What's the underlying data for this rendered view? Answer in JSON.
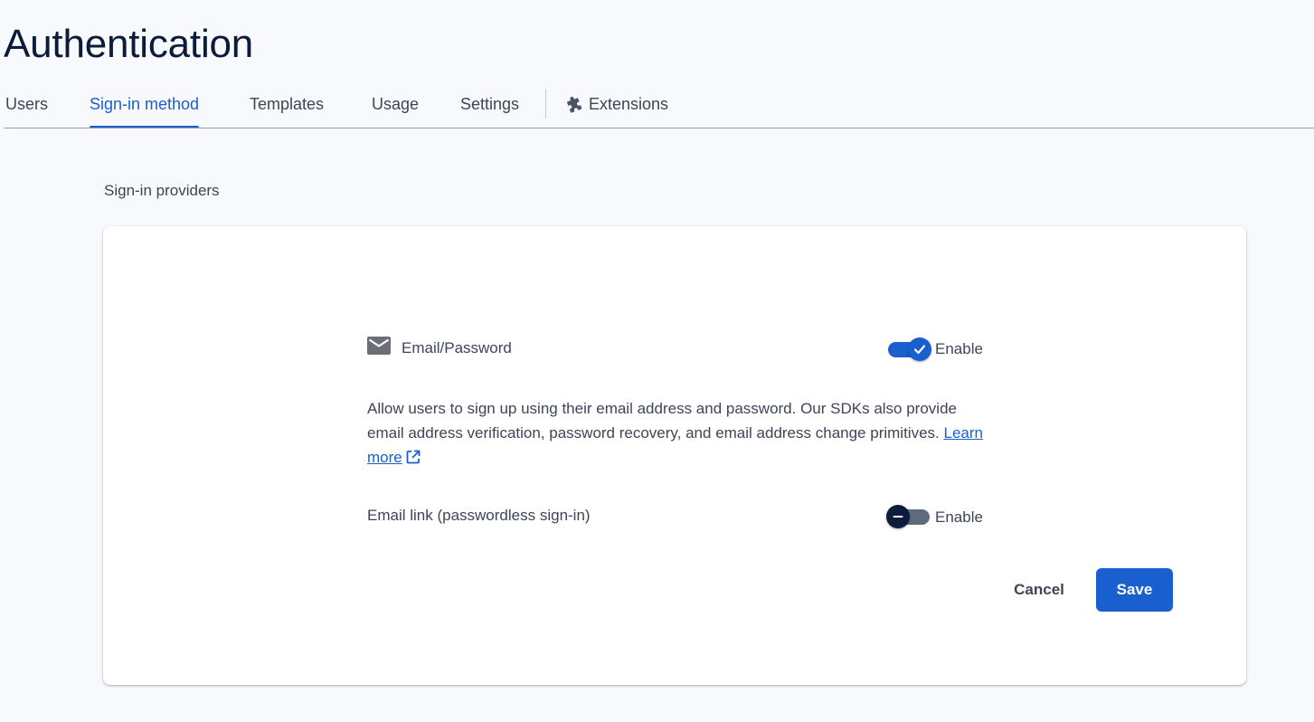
{
  "page_title": "Authentication",
  "tabs": [
    {
      "label": "Users",
      "active": false
    },
    {
      "label": "Sign-in method",
      "active": true
    },
    {
      "label": "Templates",
      "active": false
    },
    {
      "label": "Usage",
      "active": false
    },
    {
      "label": "Settings",
      "active": false
    },
    {
      "label": "Extensions",
      "active": false,
      "icon": "puzzle-piece-icon"
    }
  ],
  "section_label": "Sign-in providers",
  "provider": {
    "icon": "email-icon",
    "name": "Email/Password",
    "enable_label": "Enable",
    "enabled": true,
    "description": "Allow users to sign up using their email address and password. Our SDKs also provide email address verification, password recovery, and email address change primitives.",
    "learn_more_label": "Learn more"
  },
  "email_link": {
    "label": "Email link (passwordless sign-in)",
    "enable_label": "Enable",
    "enabled": false
  },
  "actions": {
    "cancel_label": "Cancel",
    "save_label": "Save"
  },
  "colors": {
    "accent": "#1a5fd0",
    "background": "#f8f9fd",
    "title": "#0b1b3a",
    "toggle_off_knob": "#0d1c3c"
  }
}
